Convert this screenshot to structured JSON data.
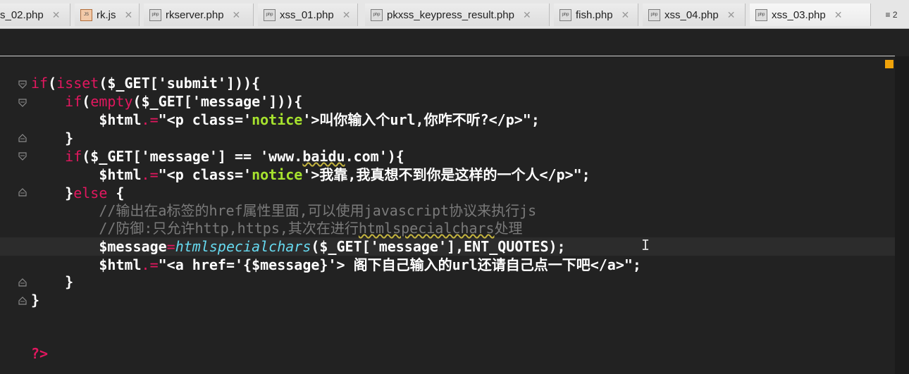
{
  "tabs": [
    {
      "label": "s_02.php",
      "icon": "php-file-icon"
    },
    {
      "label": "rk.js",
      "icon": "js-file-icon"
    },
    {
      "label": "rkserver.php",
      "icon": "php-file-icon"
    },
    {
      "label": "xss_01.php",
      "icon": "php-file-icon"
    },
    {
      "label": "pkxss_keypress_result.php",
      "icon": "php-file-icon"
    },
    {
      "label": "fish.php",
      "icon": "php-file-icon"
    },
    {
      "label": "xss_04.php",
      "icon": "php-file-icon"
    },
    {
      "label": "xss_03.php",
      "icon": "php-file-icon",
      "active": true
    }
  ],
  "tab_overflow_label": "≡ 2",
  "colors": {
    "keyword": "#e2175f",
    "comment": "#7a7a7a",
    "function": "#66d9ef",
    "marker": "#f0a30a",
    "background": "#222222"
  },
  "code": {
    "l1": {
      "a": "if",
      "b": "(",
      "c": "isset",
      "d": "($_GET['submit'])){"
    },
    "l2": {
      "indent": "    ",
      "a": "if",
      "b": "(",
      "c": "empty",
      "d": "($_GET['message'])){"
    },
    "l3": {
      "indent": "        ",
      "a": "$html",
      "op": ".=",
      "b": "\"<p class='",
      "c": "notice",
      "d": "'>叫你输入个url,你咋不听?</p>\";"
    },
    "l4": {
      "text": "    }"
    },
    "l5": {
      "indent": "    ",
      "a": "if",
      "b": "($_GET['message'] == 'www.",
      "c": "baidu",
      "d": ".com'){"
    },
    "l6": {
      "indent": "        ",
      "a": "$html",
      "op": ".=",
      "b": "\"<p class='",
      "c": "notice",
      "d": "'>我靠,我真想不到你是这样的一个人</p>\";"
    },
    "l7": {
      "indent": "    ",
      "a": "}",
      "b": "else",
      "c": " {"
    },
    "l8": {
      "indent": "        ",
      "text": "//输出在a标签的href属性里面,可以使用javascript协议来执行js"
    },
    "l9": {
      "indent": "        ",
      "a": "//防御:只允许http,https,其次在进行",
      "b": "htmlspecialchars",
      "c": "处理"
    },
    "l10": {
      "indent": "        ",
      "a": "$message",
      "op": "=",
      "fn": "htmlspecialchars",
      "b": "($_GET['message'],ENT_QUOTES);"
    },
    "l11": {
      "indent": "        ",
      "a": "$html",
      "op": ".=",
      "b": "\"<a href='{$message}'> 阁下自己输入的url还请自己点一下吧</a>\";"
    },
    "l12": {
      "text": "    }"
    },
    "l13": {
      "text": "}"
    },
    "l14": {
      "text": "?>"
    }
  }
}
